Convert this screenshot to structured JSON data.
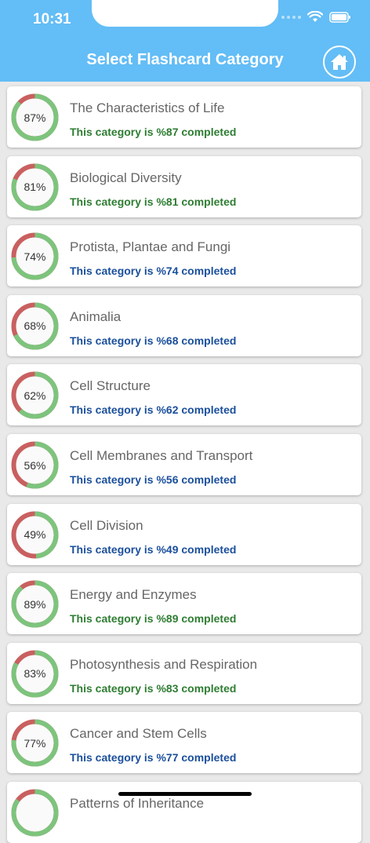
{
  "status": {
    "time": "10:31"
  },
  "header": {
    "title": "Select Flashcard Category",
    "home_icon": "home-icon"
  },
  "colors": {
    "header": "#63bdf6",
    "ring_done": "#7dc47d",
    "ring_todo": "#c96060",
    "text_green": "#2e7d32",
    "text_blue": "#1a4f9c"
  },
  "categories": [
    {
      "title": "The Characteristics of Life",
      "percent": 87,
      "percent_label": "87%",
      "subtitle": "This category is %87 completed",
      "tone": "green"
    },
    {
      "title": "Biological Diversity",
      "percent": 81,
      "percent_label": "81%",
      "subtitle": "This category is %81 completed",
      "tone": "green"
    },
    {
      "title": "Protista, Plantae and Fungi",
      "percent": 74,
      "percent_label": "74%",
      "subtitle": "This category is %74 completed",
      "tone": "blue"
    },
    {
      "title": "Animalia",
      "percent": 68,
      "percent_label": "68%",
      "subtitle": "This category is %68 completed",
      "tone": "blue"
    },
    {
      "title": "Cell Structure",
      "percent": 62,
      "percent_label": "62%",
      "subtitle": "This category is %62 completed",
      "tone": "blue"
    },
    {
      "title": "Cell Membranes and Transport",
      "percent": 56,
      "percent_label": "56%",
      "subtitle": "This category is %56 completed",
      "tone": "blue"
    },
    {
      "title": "Cell Division",
      "percent": 49,
      "percent_label": "49%",
      "subtitle": "This category is %49 completed",
      "tone": "blue"
    },
    {
      "title": "Energy and Enzymes",
      "percent": 89,
      "percent_label": "89%",
      "subtitle": "This category is %89 completed",
      "tone": "green"
    },
    {
      "title": "Photosynthesis and Respiration",
      "percent": 83,
      "percent_label": "83%",
      "subtitle": "This category is %83 completed",
      "tone": "green"
    },
    {
      "title": "Cancer and Stem Cells",
      "percent": 77,
      "percent_label": "77%",
      "subtitle": "This category is %77 completed",
      "tone": "blue"
    },
    {
      "title": "Patterns of Inheritance",
      "percent": 85,
      "percent_label": "",
      "subtitle": "",
      "tone": "green"
    }
  ]
}
